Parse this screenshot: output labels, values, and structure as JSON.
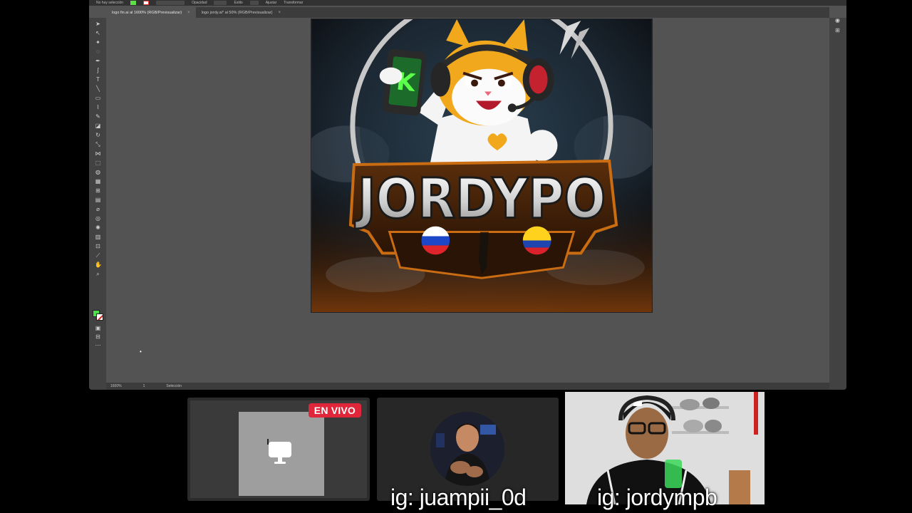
{
  "app": {
    "control_bar": {
      "left_text": "No hay selección",
      "items": [
        "Opacidad",
        "Estilo",
        "Ajustar",
        "Transformar"
      ]
    },
    "tabs": [
      {
        "label": "logo fin.ai al 1600% (RGB/Previsualizar)",
        "active": true
      },
      {
        "label": "logo jordy.ai* al 50% (RGB/Previsualizar)",
        "active": false
      }
    ],
    "status": {
      "zoom": "1600%",
      "artboard": "1",
      "tool": "Selección"
    },
    "colors": {
      "fill": "#4be04b",
      "stroke": "#ffffff",
      "ui_bg": "#535353"
    }
  },
  "artwork": {
    "title_text": "JORDYPO",
    "mascot_phone_letter": "K",
    "flags": [
      "russia-flag-icon",
      "colombia-flag-icon"
    ]
  },
  "stream": {
    "live_badge": "EN VIVO",
    "guest_handle": "ig: juampii_0d",
    "host_handle": "ig: jordympb"
  }
}
